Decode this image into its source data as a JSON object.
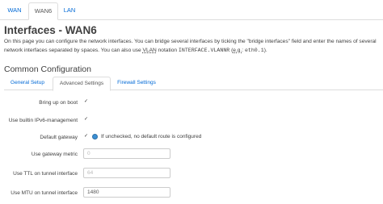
{
  "top_tabs": [
    {
      "label": "WAN"
    },
    {
      "label": "WAN6"
    },
    {
      "label": "LAN"
    }
  ],
  "page": {
    "title": "Interfaces - WAN6",
    "description_part1": "On this page you can configure the network interfaces. You can bridge several interfaces by ticking the \"bridge interfaces\" field and enter the names of several network interfaces separated by spaces. You can also use ",
    "description_vlan": "VLAN",
    "description_part2": " notation ",
    "description_code1": "INTERFACE.VLANNR",
    "description_part3": " (",
    "description_eg": "e.g.",
    "description_part4": ": ",
    "description_code2": "eth0.1",
    "description_part5": ")."
  },
  "section": {
    "title": "Common Configuration"
  },
  "sub_tabs": [
    {
      "label": "General Setup"
    },
    {
      "label": "Advanced Settings"
    },
    {
      "label": "Firewall Settings"
    }
  ],
  "fields": {
    "bring_up_on_boot": {
      "label": "Bring up on boot",
      "checked": true
    },
    "ipv6_management": {
      "label": "Use builtin IPv6-management",
      "checked": true
    },
    "default_gateway": {
      "label": "Default gateway",
      "checked": true,
      "hint": "If unchecked, no default route is configured"
    },
    "gateway_metric": {
      "label": "Use gateway metric",
      "placeholder": "0",
      "value": ""
    },
    "ttl_tunnel": {
      "label": "Use TTL on tunnel interface",
      "placeholder": "64",
      "value": ""
    },
    "mtu_tunnel": {
      "label": "Use MTU on tunnel interface",
      "placeholder": "",
      "value": "1480"
    }
  },
  "colors": {
    "link": "#0069d6",
    "text": "#404040",
    "hint_icon": "#3b8fd4"
  }
}
